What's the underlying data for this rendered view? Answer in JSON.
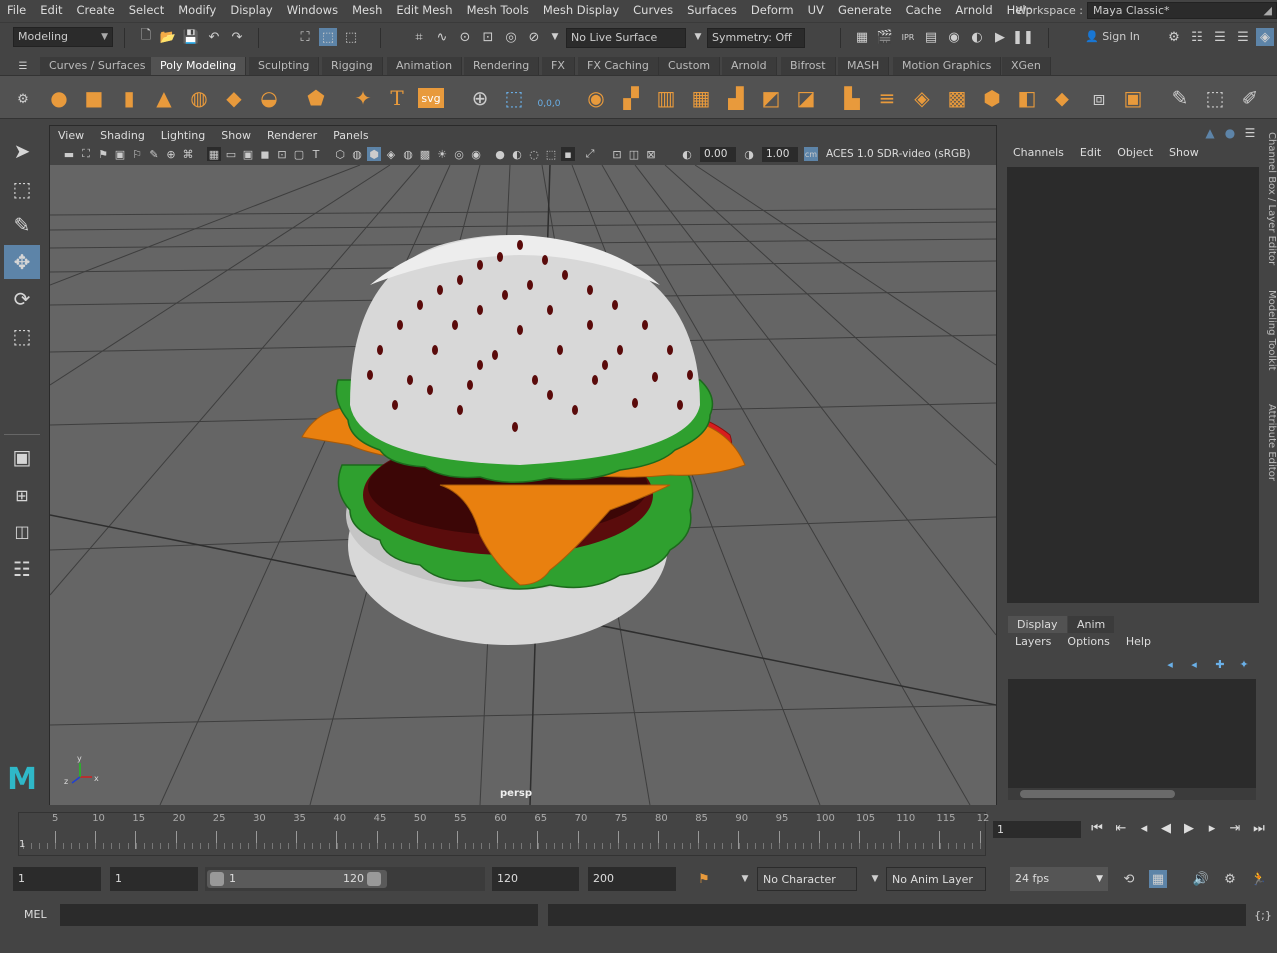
{
  "menubar": {
    "items": [
      "File",
      "Edit",
      "Create",
      "Select",
      "Modify",
      "Display",
      "Windows",
      "Mesh",
      "Edit Mesh",
      "Mesh Tools",
      "Mesh Display",
      "Curves",
      "Surfaces",
      "Deform",
      "UV",
      "Generate",
      "Cache",
      "Arnold",
      "Help"
    ],
    "workspace_label": "Workspace :",
    "workspace_value": "Maya Classic*"
  },
  "statusline": {
    "menuset": "Modeling",
    "live_surface": "No Live Surface",
    "symmetry": "Symmetry: Off",
    "sign_in": "Sign In"
  },
  "shelf": {
    "tabs": [
      "Curves / Surfaces",
      "Poly Modeling",
      "Sculpting",
      "Rigging",
      "Animation",
      "Rendering",
      "FX",
      "FX Caching",
      "Custom",
      "Arnold",
      "Bifrost",
      "MASH",
      "Motion Graphics",
      "XGen"
    ],
    "active_tab": "Poly Modeling",
    "icon_text_label": "T",
    "svg_label": "svg",
    "count_label": "0,0,0"
  },
  "viewport": {
    "menu": [
      "View",
      "Shading",
      "Lighting",
      "Show",
      "Renderer",
      "Panels"
    ],
    "field_exposure": "0.00",
    "field_gamma": "1.00",
    "colorspace": "ACES 1.0 SDR-video (sRGB)",
    "camera_label": "persp",
    "axis_x": "x",
    "axis_y": "y",
    "axis_z": "z"
  },
  "channelbox": {
    "menu": [
      "Channels",
      "Edit",
      "Object",
      "Show"
    ]
  },
  "layereditor": {
    "tabs": [
      "Display",
      "Anim"
    ],
    "menu": [
      "Layers",
      "Options",
      "Help"
    ]
  },
  "sidetabs": [
    "Channel Box / Layer Editor",
    "Modeling Toolkit",
    "Attribute Editor"
  ],
  "timeslider": {
    "ticks": [
      5,
      10,
      15,
      20,
      25,
      30,
      35,
      40,
      45,
      50,
      55,
      60,
      65,
      70,
      75,
      80,
      85,
      90,
      95,
      100,
      105,
      110,
      115,
      12
    ],
    "current_marker": "1",
    "current_frame": "1"
  },
  "rangeslider": {
    "start": "1",
    "anim_start": "1",
    "range_start": "1",
    "range_end": "120",
    "end": "120",
    "anim_end": "200",
    "character_set": "No Character Set",
    "anim_layer": "No Anim Layer",
    "fps": "24 fps"
  },
  "cmdline": {
    "label": "MEL"
  },
  "colors": {
    "accent_blue": "#5d84a8",
    "shelf_orange": "#e89a3c",
    "bun": "#d8d8d8",
    "seed": "#5a0a0a",
    "lettuce": "#2fa02f",
    "cheese": "#e9800f",
    "tomato": "#d81d1d",
    "patty": "#5a0c0c"
  }
}
